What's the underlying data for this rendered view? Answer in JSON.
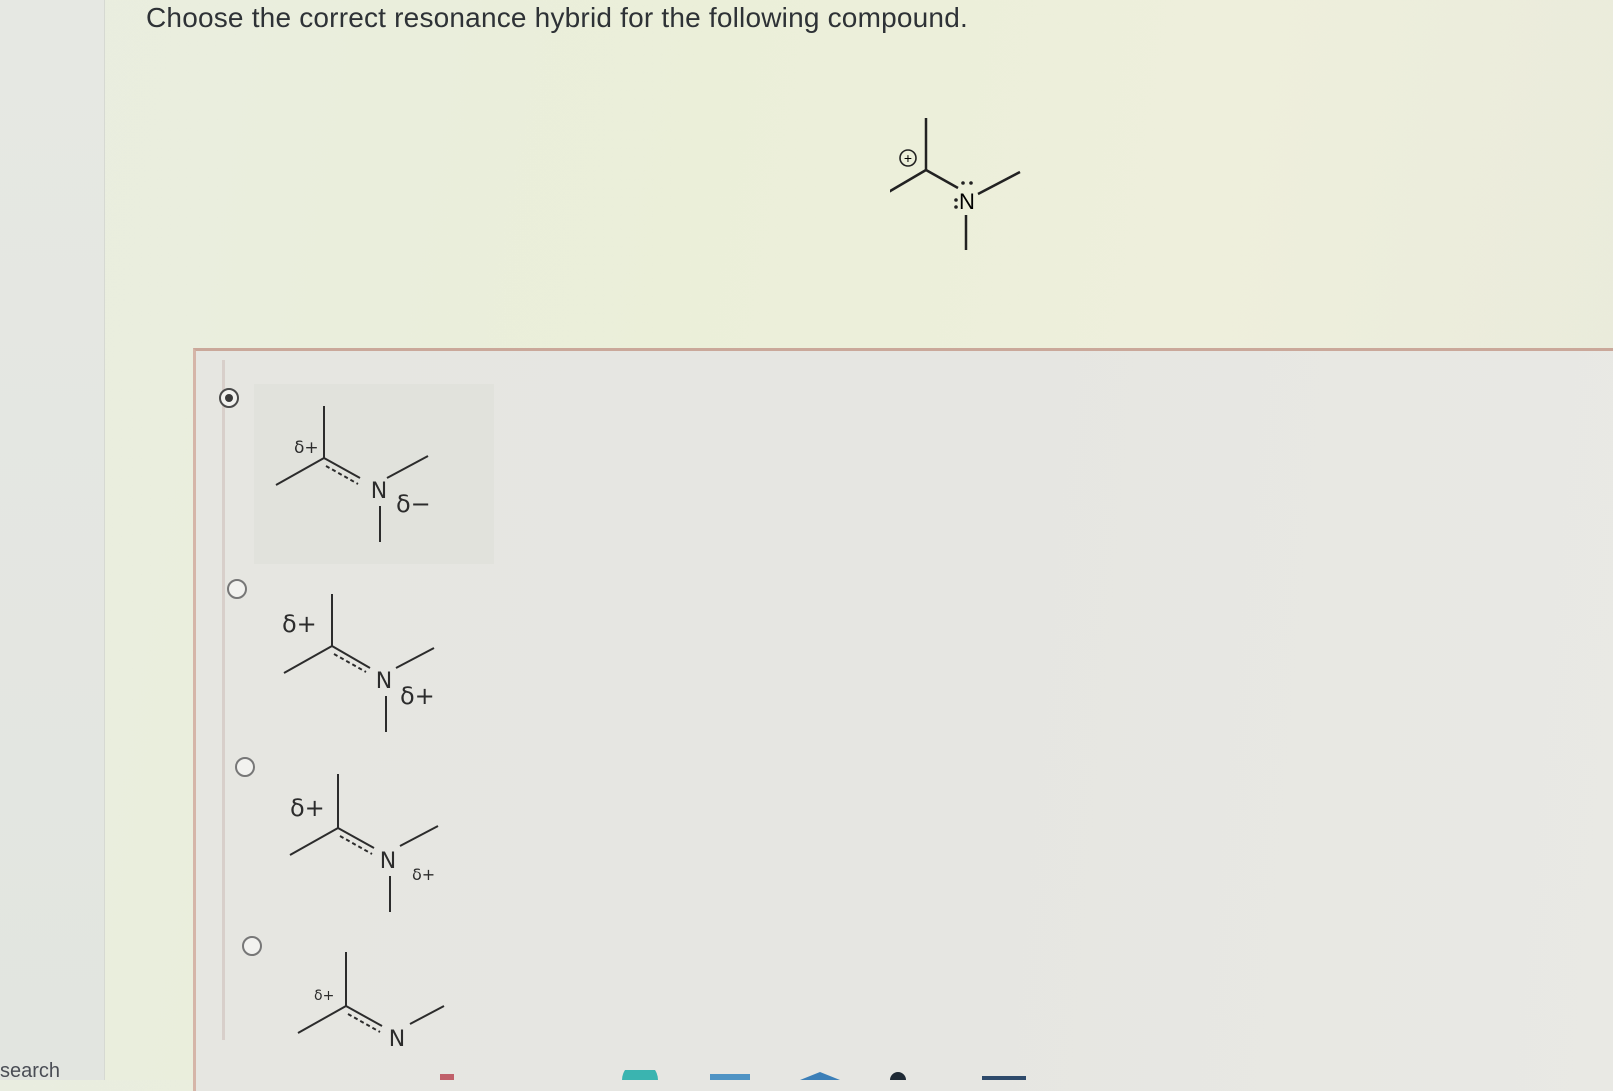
{
  "question": {
    "text": "Choose the correct resonance hybrid for the following compound."
  },
  "compound": {
    "charge": "+",
    "atom": "N",
    "lone_pair": ":"
  },
  "options": [
    {
      "selected": true,
      "delta_left": "δ+",
      "atom": "N",
      "delta_right": "δ−"
    },
    {
      "selected": false,
      "delta_left": "δ+",
      "atom": "N",
      "delta_right": "δ+"
    },
    {
      "selected": false,
      "delta_left": "δ+",
      "atom": "N",
      "delta_right": "δ+"
    },
    {
      "selected": false,
      "delta_left": "δ+",
      "atom": "N",
      "delta_right": ""
    }
  ],
  "taskbar": {
    "search_label": "search"
  }
}
